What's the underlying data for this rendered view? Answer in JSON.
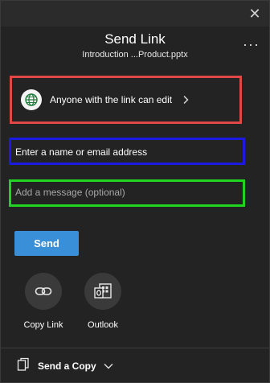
{
  "window": {
    "close_glyph": "✕"
  },
  "header": {
    "title": "Send Link",
    "filename": "Introduction ...Product.pptx",
    "more_glyph": "···"
  },
  "permission": {
    "label": "Anyone with the link can edit",
    "icon": "globe-icon"
  },
  "recipients": {
    "placeholder": "Enter a name or email address",
    "value": ""
  },
  "message": {
    "placeholder": "Add a message (optional)",
    "value": ""
  },
  "send_button": {
    "label": "Send",
    "color": "#3a8fd9"
  },
  "share_options": [
    {
      "label": "Copy Link",
      "icon": "link-icon"
    },
    {
      "label": "Outlook",
      "icon": "outlook-icon"
    }
  ],
  "footer": {
    "send_copy_label": "Send a Copy",
    "icon": "document-copy-icon"
  },
  "colors": {
    "background": "#232323",
    "permission_outline": "#e04848",
    "recipients_outline": "#1a1ae0",
    "message_outline": "#22d422"
  }
}
